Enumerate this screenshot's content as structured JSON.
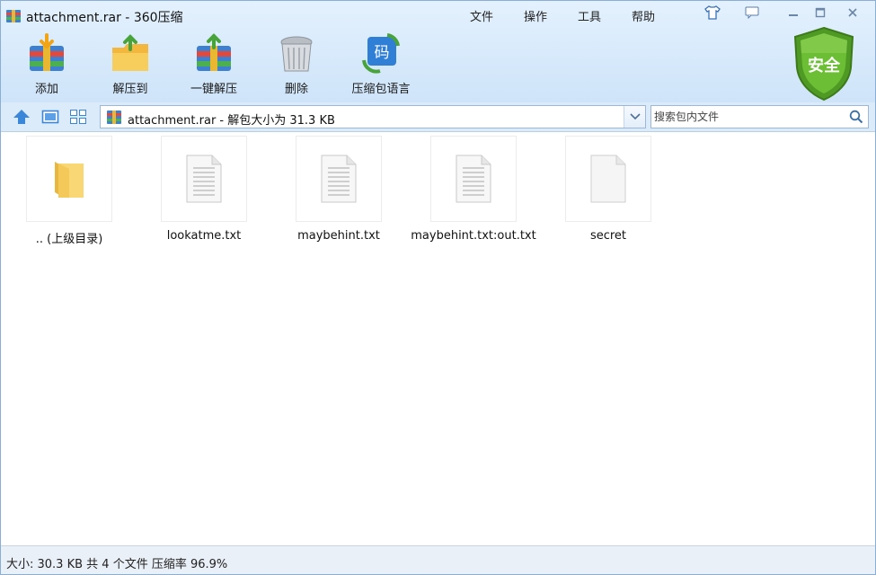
{
  "window": {
    "title": "attachment.rar - 360压缩"
  },
  "menu": [
    {
      "label": "文件"
    },
    {
      "label": "操作"
    },
    {
      "label": "工具"
    },
    {
      "label": "帮助"
    }
  ],
  "toolbar": [
    {
      "label": "添加",
      "icon": "add-archive-icon"
    },
    {
      "label": "解压到",
      "icon": "extract-to-icon"
    },
    {
      "label": "一键解压",
      "icon": "one-click-extract-icon"
    },
    {
      "label": "删除",
      "icon": "trash-icon"
    },
    {
      "label": "压缩包语言",
      "icon": "archive-language-icon"
    }
  ],
  "badge": {
    "label": "安全",
    "color": "#5aa52a"
  },
  "address": {
    "text": "attachment.rar - 解包大小为 31.3 KB"
  },
  "search": {
    "placeholder": "搜索包内文件",
    "value": ""
  },
  "files": [
    {
      "name": ".. (上级目录)",
      "icon": "folder-icon"
    },
    {
      "name": "lookatme.txt",
      "icon": "text-file-icon"
    },
    {
      "name": "maybehint.txt",
      "icon": "text-file-icon"
    },
    {
      "name": "maybehint.txt:out.txt",
      "icon": "text-file-icon"
    },
    {
      "name": "secret",
      "icon": "blank-file-icon"
    }
  ],
  "status": {
    "text": "大小: 30.3 KB 共 4 个文件 压缩率 96.9%"
  },
  "colors": {
    "chrome": "#d6e9fb",
    "accent": "#3a86d8",
    "border": "#8aaed6"
  }
}
